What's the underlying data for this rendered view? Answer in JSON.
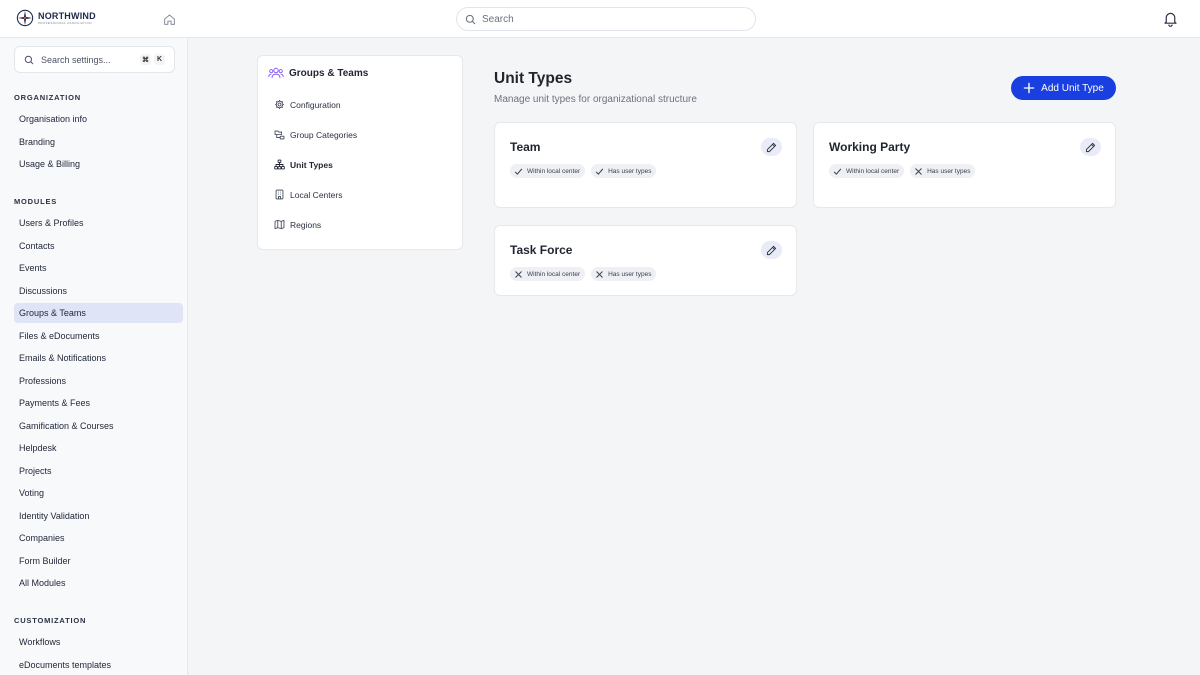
{
  "header": {
    "logo_name": "NORTHWIND",
    "logo_sub": "PROFESSIONAL ASSOCIATION",
    "search_placeholder": "Search"
  },
  "sidebar": {
    "search_placeholder": "Search settings...",
    "shortcut_keys": [
      "⌘",
      "K"
    ],
    "sections": [
      {
        "title": "ORGANIZATION",
        "items": [
          "Organisation info",
          "Branding",
          "Usage & Billing"
        ]
      },
      {
        "title": "MODULES",
        "items": [
          "Users & Profiles",
          "Contacts",
          "Events",
          "Discussions",
          "Groups & Teams",
          "Files & eDocuments",
          "Emails & Notifications",
          "Professions",
          "Payments & Fees",
          "Gamification & Courses",
          "Helpdesk",
          "Projects",
          "Voting",
          "Identity Validation",
          "Companies",
          "Form Builder",
          "All Modules"
        ]
      },
      {
        "title": "CUSTOMIZATION",
        "items": [
          "Workflows",
          "eDocuments templates"
        ]
      }
    ],
    "active_item": "Groups & Teams"
  },
  "submenu": {
    "title": "Groups & Teams",
    "items": [
      {
        "label": "Configuration",
        "icon": "gear-icon"
      },
      {
        "label": "Group Categories",
        "icon": "folder-tree-icon"
      },
      {
        "label": "Unit Types",
        "icon": "hierarchy-icon"
      },
      {
        "label": "Local Centers",
        "icon": "building-icon"
      },
      {
        "label": "Regions",
        "icon": "map-icon"
      }
    ],
    "active_item": "Unit Types"
  },
  "main": {
    "title": "Unit Types",
    "subtitle": "Manage unit types for organizational structure",
    "add_button_label": "Add Unit Type",
    "cards": [
      {
        "title": "Team",
        "badges": [
          {
            "label": "Within local center",
            "enabled": true
          },
          {
            "label": "Has user types",
            "enabled": true
          }
        ]
      },
      {
        "title": "Working Party",
        "badges": [
          {
            "label": "Within local center",
            "enabled": true
          },
          {
            "label": "Has user types",
            "enabled": false
          }
        ]
      },
      {
        "title": "Task Force",
        "badges": [
          {
            "label": "Within local center",
            "enabled": false
          },
          {
            "label": "Has user types",
            "enabled": false
          }
        ]
      }
    ]
  },
  "colors": {
    "accent": "#1a3fe0",
    "active_nav_bg": "#dfe4f7",
    "groups_icon": "#8b5cf6"
  }
}
